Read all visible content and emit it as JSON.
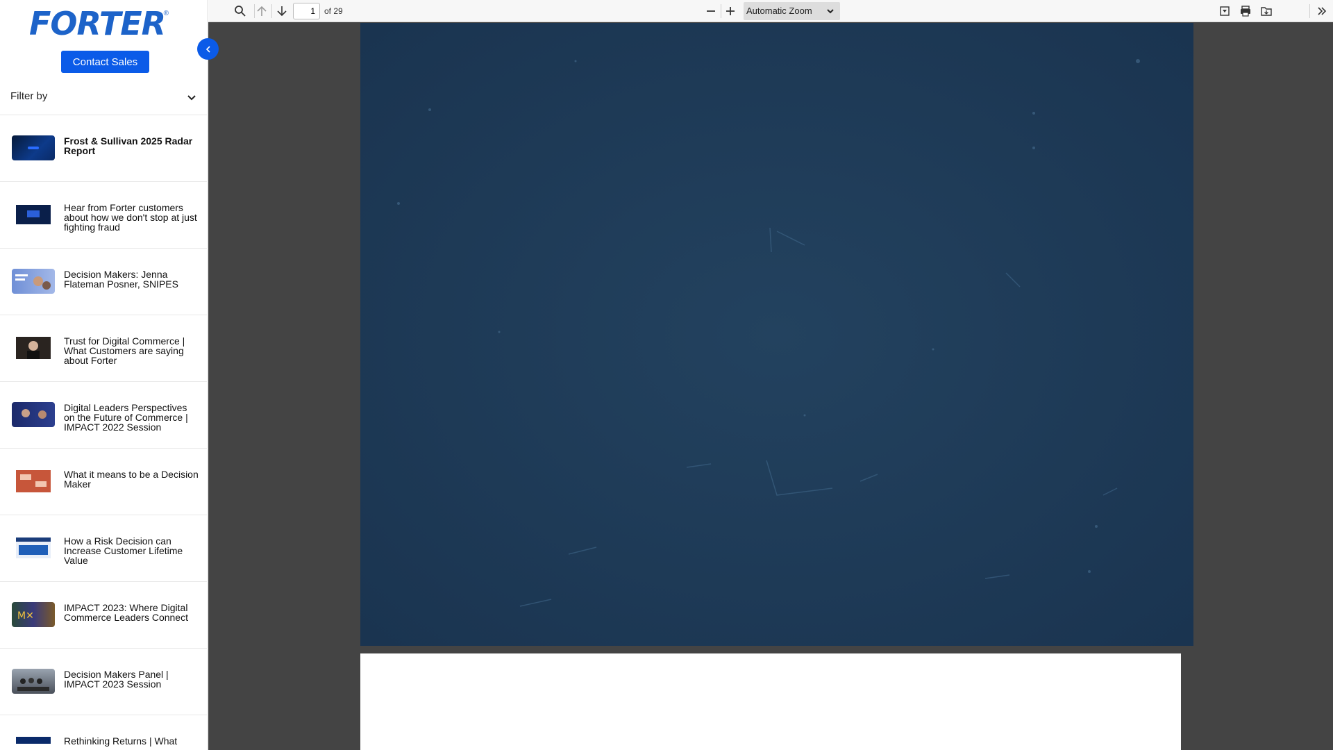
{
  "brand": {
    "logo_text": "FORTER",
    "reg_mark": "®",
    "color": "#1d63c9"
  },
  "sidebar": {
    "contact_button": "Contact Sales",
    "collapse_icon": "chevron-left-icon",
    "filter_label": "Filter by",
    "items": [
      {
        "title": "Frost & Sullivan 2025 Radar Report",
        "bold": true
      },
      {
        "title": "Hear from Forter customers about how we don't stop at just fighting fraud"
      },
      {
        "title": "Decision Makers: Jenna Flateman Posner, SNIPES"
      },
      {
        "title": "Trust for Digital Commerce | What Customers are saying about Forter"
      },
      {
        "title": "Digital Leaders Perspectives on the Future of Commerce | IMPACT 2022 Session"
      },
      {
        "title": "What it means to be a Decision Maker"
      },
      {
        "title": "How a Risk Decision can Increase Customer Lifetime Value"
      },
      {
        "title": "IMPACT 2023: Where Digital Commerce Leaders Connect"
      },
      {
        "title": "Decision Makers Panel | IMPACT 2023 Session"
      },
      {
        "title": "Rethinking Returns | What"
      }
    ]
  },
  "toolbar": {
    "page_number": "1",
    "page_of": "of 29",
    "zoom": "Automatic Zoom"
  },
  "colors": {
    "accent": "#0b5be8",
    "viewer_bg": "#444444",
    "page_bg": "#1f3b59"
  }
}
